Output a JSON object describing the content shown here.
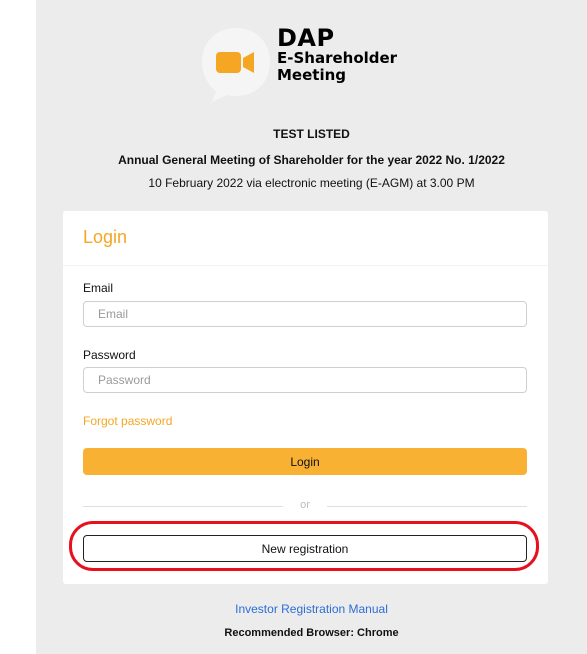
{
  "logo": {
    "line1": "DAP",
    "line2": "E-Shareholder",
    "line3": "Meeting",
    "icon": "video-camera-chat-bubble-icon",
    "bubble_color": "#f5f5f5",
    "camera_color": "#f5a623"
  },
  "meeting": {
    "company": "TEST LISTED",
    "title": "Annual General Meeting of Shareholder for the year 2022 No. 1/2022",
    "date": "10 February 2022 via electronic meeting (E-AGM) at 3.00 PM"
  },
  "login": {
    "heading": "Login",
    "email_label": "Email",
    "email_placeholder": "Email",
    "email_value": "",
    "password_label": "Password",
    "password_placeholder": "Password",
    "password_value": "",
    "forgot_label": "Forgot password",
    "login_label": "Login",
    "or_label": "or",
    "register_label": "New registration"
  },
  "footer": {
    "manual_label": "Investor Registration Manual",
    "browser_note": "Recommended Browser: Chrome"
  },
  "colors": {
    "accent": "#f5a623",
    "button": "#f8b133",
    "link": "#2b6ed6",
    "highlight": "#e8101c",
    "background": "#ececec"
  }
}
